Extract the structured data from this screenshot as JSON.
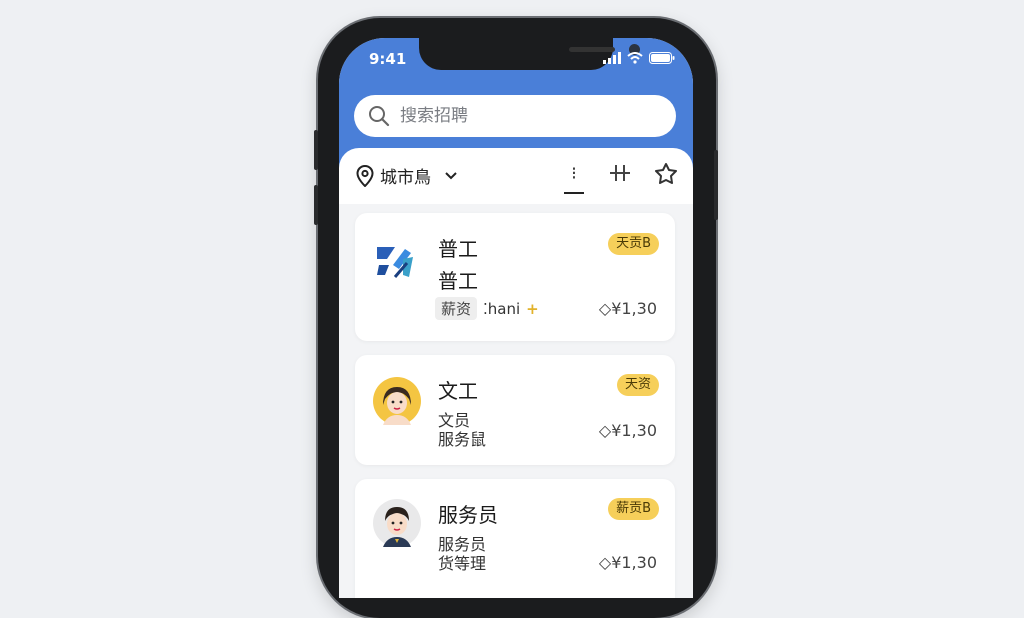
{
  "status_bar": {
    "time": "9:41"
  },
  "search": {
    "placeholder": "搜索招聘"
  },
  "filter": {
    "city_label": "城市鳥",
    "tab_active_icon": "⁝"
  },
  "jobs": [
    {
      "title": "普工",
      "subtitle": "普工",
      "tag": "薪资",
      "extra": "⁚hani",
      "plus": "+",
      "badge": "天贡B",
      "salary": "◇¥1,30"
    },
    {
      "title": "文工",
      "line1": "文员",
      "line2": "服务鼠",
      "badge": "天资",
      "salary": "◇¥1,30"
    },
    {
      "title": "服务员",
      "line1": "服务员",
      "line2": "货等理",
      "badge": "薪贡B",
      "salary": "◇¥1,30"
    }
  ],
  "colors": {
    "header": "#4a7fd8",
    "badge": "#f6cf5a"
  }
}
